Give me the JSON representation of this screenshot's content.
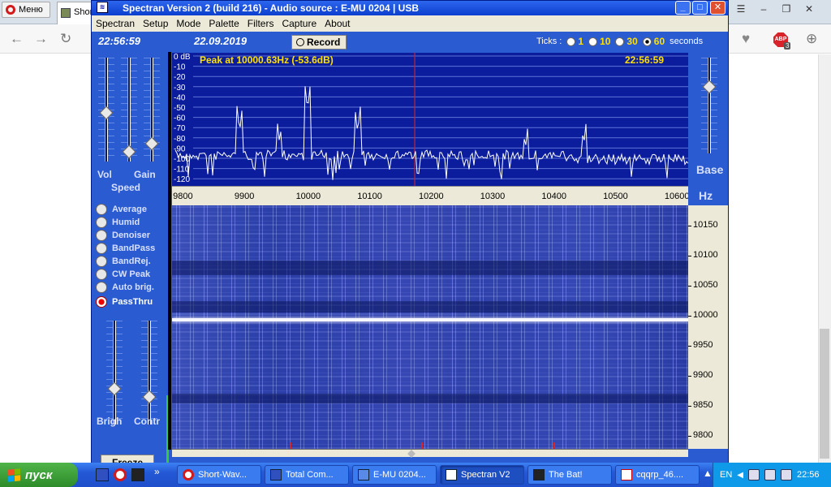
{
  "browser": {
    "menu_label": "Меню",
    "tab_label": "Shor",
    "badge_count": "3"
  },
  "window": {
    "title": "Spectran Version 2 (build 216) - Audio source  :  E-MU 0204  |  USB",
    "menu": [
      "Spectran",
      "Setup",
      "Mode",
      "Palette",
      "Filters",
      "Capture",
      "About"
    ]
  },
  "toolbar": {
    "time": "22:56:59",
    "date": "22.09.2019",
    "record_label": "Record",
    "ticks_label": "Ticks :",
    "ticks_options": [
      "1",
      "10",
      "30",
      "60"
    ],
    "ticks_selected": "60",
    "seconds_label": "seconds"
  },
  "left_panel": {
    "vol_label": "Vol",
    "gain_label": "Gain",
    "speed_label": "Speed",
    "brigh_label": "Brigh",
    "contr_label": "Contr",
    "freeze_label": "Freeze",
    "options": [
      {
        "label": "Average",
        "on": false
      },
      {
        "label": "Humid",
        "on": false
      },
      {
        "label": "Denoiser",
        "on": false
      },
      {
        "label": "BandPass",
        "on": false
      },
      {
        "label": "BandRej.",
        "on": false
      },
      {
        "label": "CW Peak",
        "on": false
      },
      {
        "label": "Auto brig.",
        "on": false
      },
      {
        "label": "PassThru",
        "on": true
      }
    ]
  },
  "right_panel": {
    "base_label": "Base",
    "hz_label": "Hz"
  },
  "spectrum": {
    "peak_text": "Peak at 10000.63Hz (-53.6dB)",
    "time": "22:56:59",
    "db_labels": [
      "0 dB",
      "-10",
      "-20",
      "-30",
      "-40",
      "-50",
      "-60",
      "-70",
      "-80",
      "-90",
      "-100",
      "-110",
      "-120"
    ],
    "freq_labels": [
      "9800",
      "9900",
      "10000",
      "10100",
      "10200",
      "10300",
      "10400",
      "10500",
      "10600"
    ],
    "cursor_hz": 10175,
    "range_hz": [
      9780,
      10620
    ]
  },
  "waterfall": {
    "freq_labels": [
      "10150",
      "10100",
      "10050",
      "10000",
      "9950",
      "9900",
      "9850",
      "9800"
    ]
  },
  "taskbar": {
    "start_label": "пуск",
    "tasks": [
      {
        "label": "Short-Wav...",
        "active": false
      },
      {
        "label": "Total Com...",
        "active": false
      },
      {
        "label": "E-MU 0204...",
        "active": false
      },
      {
        "label": "Spectran V2",
        "active": true
      },
      {
        "label": "The Bat!",
        "active": false
      },
      {
        "label": "cqqrp_46....",
        "active": false
      }
    ],
    "lang": "EN",
    "clock": "22:56"
  },
  "colors": {
    "spectrum_bg": "#0b1d9c",
    "label_yellow": "#ffe000",
    "cursor_red": "#cc2222",
    "panel_blue": "#2a5bd0"
  }
}
